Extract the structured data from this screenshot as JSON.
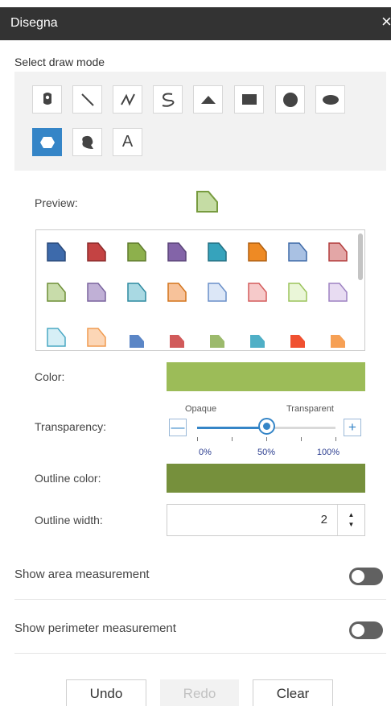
{
  "panel": {
    "title": "Disegna",
    "close_glyph": "×"
  },
  "draw_mode": {
    "label": "Select draw mode",
    "tools": [
      {
        "name": "point",
        "icon": "marker-pin-icon",
        "active": false
      },
      {
        "name": "line",
        "icon": "line-icon",
        "active": false
      },
      {
        "name": "polyline",
        "icon": "polyline-icon",
        "active": false
      },
      {
        "name": "freehand-polyline",
        "icon": "freehand-line-icon",
        "active": false
      },
      {
        "name": "triangle",
        "icon": "triangle-icon",
        "active": false
      },
      {
        "name": "rectangle",
        "icon": "rectangle-icon",
        "active": false
      },
      {
        "name": "circle",
        "icon": "circle-icon",
        "active": false
      },
      {
        "name": "ellipse",
        "icon": "ellipse-icon",
        "active": false
      },
      {
        "name": "polygon",
        "icon": "polygon-icon",
        "active": true
      },
      {
        "name": "freehand-polygon",
        "icon": "freehand-polygon-icon",
        "active": false
      },
      {
        "name": "text",
        "icon": "text-icon",
        "label": "A",
        "active": false
      }
    ]
  },
  "preview": {
    "label": "Preview:",
    "fill": "#c5dca4",
    "outline": "#779b3f"
  },
  "symbols": [
    {
      "fill": "#3d6aab",
      "stroke": "#29497a",
      "kind": "outlined"
    },
    {
      "fill": "#c44343",
      "stroke": "#8c2a2a",
      "kind": "outlined"
    },
    {
      "fill": "#8db04c",
      "stroke": "#5e7a2c",
      "kind": "outlined"
    },
    {
      "fill": "#8364a8",
      "stroke": "#5a4478",
      "kind": "outlined"
    },
    {
      "fill": "#36a3bc",
      "stroke": "#226f82",
      "kind": "outlined"
    },
    {
      "fill": "#ee8a24",
      "stroke": "#b05f10",
      "kind": "outlined"
    },
    {
      "fill": "#a9c1e3",
      "stroke": "#3f6aa8",
      "kind": "outlined"
    },
    {
      "fill": "#e3a6a6",
      "stroke": "#b23c3c",
      "kind": "outlined"
    },
    {
      "fill": "#c8dcaa",
      "stroke": "#6e8f37",
      "kind": "outlined"
    },
    {
      "fill": "#c0b0d6",
      "stroke": "#7a649e",
      "kind": "outlined"
    },
    {
      "fill": "#a9d9e3",
      "stroke": "#2e8aa0",
      "kind": "outlined"
    },
    {
      "fill": "#f7c29a",
      "stroke": "#d3741c",
      "kind": "outlined"
    },
    {
      "fill": "#dce7f7",
      "stroke": "#6a8fc8",
      "kind": "outlined"
    },
    {
      "fill": "#f6caca",
      "stroke": "#d45c5c",
      "kind": "outlined"
    },
    {
      "fill": "#eaf6d8",
      "stroke": "#9bc35c",
      "kind": "outlined"
    },
    {
      "fill": "#e8dcf2",
      "stroke": "#9d82c2",
      "kind": "outlined"
    },
    {
      "fill": "#d6eff6",
      "stroke": "#4aa8c4",
      "kind": "outlined"
    },
    {
      "fill": "#fcd6b6",
      "stroke": "#f09b50",
      "kind": "outlined"
    },
    {
      "fill": "#5b86c6",
      "stroke": "#5b86c6",
      "kind": "solid"
    },
    {
      "fill": "#d15a5a",
      "stroke": "#d15a5a",
      "kind": "solid"
    },
    {
      "fill": "#9cba6c",
      "stroke": "#9cba6c",
      "kind": "solid"
    },
    {
      "fill": "#4fafc6",
      "stroke": "#4fafc6",
      "kind": "solid"
    },
    {
      "fill": "#f05030",
      "stroke": "#f05030",
      "kind": "solid"
    },
    {
      "fill": "#f6a055",
      "stroke": "#f6a055",
      "kind": "solid"
    }
  ],
  "color": {
    "label": "Color:",
    "value": "#9cbc58"
  },
  "transparency": {
    "label": "Transparency:",
    "left_label": "Opaque",
    "right_label": "Transparent",
    "value": 0.5,
    "ticks": [
      0,
      0.25,
      0.5,
      0.75,
      1
    ],
    "tick_labels": [
      "0%",
      "50%",
      "100%"
    ],
    "minus_glyph": "—",
    "plus_glyph": "+"
  },
  "outline_color": {
    "label": "Outline color:",
    "value": "#76903c"
  },
  "outline_width": {
    "label": "Outline width:",
    "value": "2",
    "up_glyph": "▲",
    "down_glyph": "▼"
  },
  "toggles": {
    "area": {
      "label": "Show area measurement",
      "on": false
    },
    "perimeter": {
      "label": "Show perimeter measurement",
      "on": false
    }
  },
  "actions": {
    "undo": "Undo",
    "redo": "Redo",
    "clear": "Clear"
  }
}
